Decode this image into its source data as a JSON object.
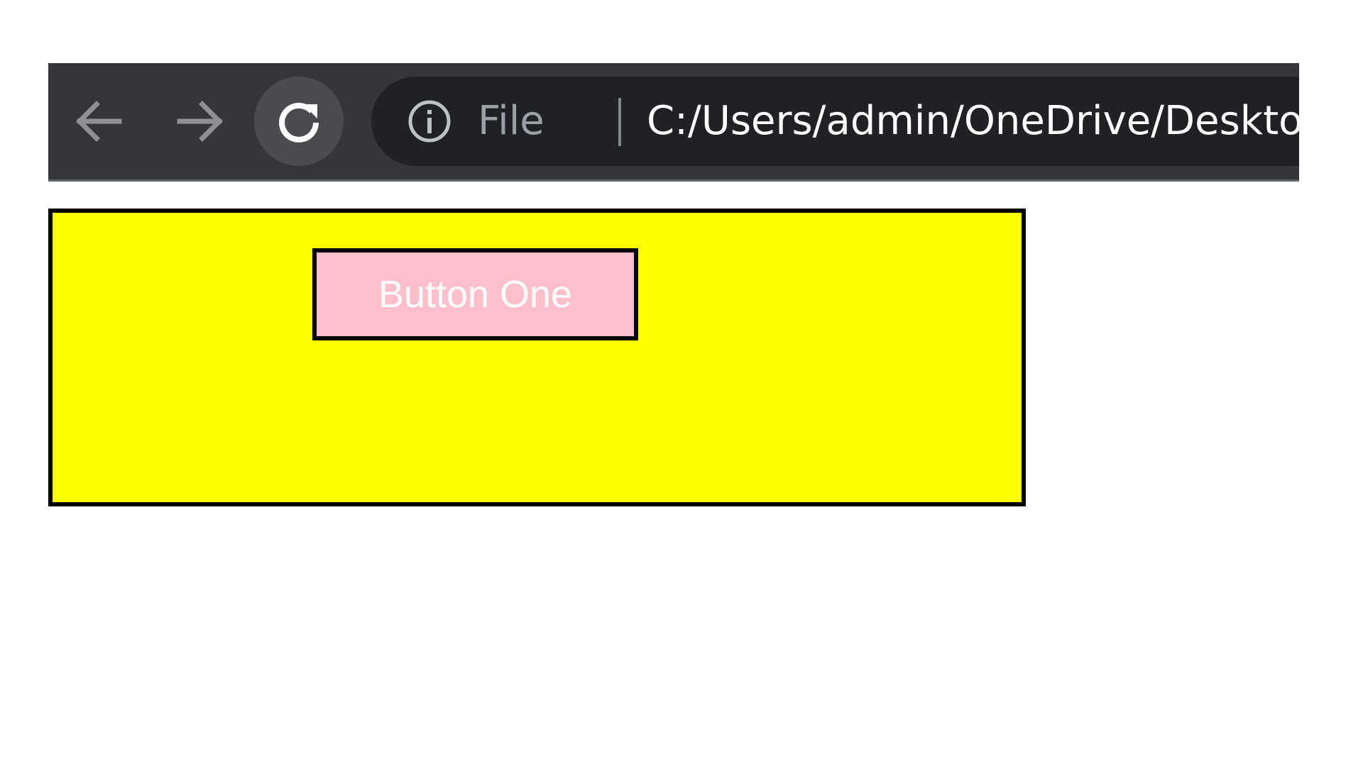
{
  "browser": {
    "toolbar": {
      "back_icon": "arrow-left-icon",
      "forward_icon": "arrow-right-icon",
      "reload_icon": "reload-icon"
    },
    "address_bar": {
      "info_icon": "info-circle-icon",
      "scheme_label": "File",
      "url": "C:/Users/admin/OneDrive/Desktop/"
    },
    "colors": {
      "toolbar_bg": "#35363a",
      "omnibox_bg": "#202124",
      "icon_dim": "#8e9094",
      "icon_light": "#ffffff"
    }
  },
  "page": {
    "panel_color": "#ffff00",
    "button_one": {
      "label": "Button One",
      "background": "#ffc0cb",
      "text_color": "#ffffff",
      "border_color": "#000000"
    }
  }
}
